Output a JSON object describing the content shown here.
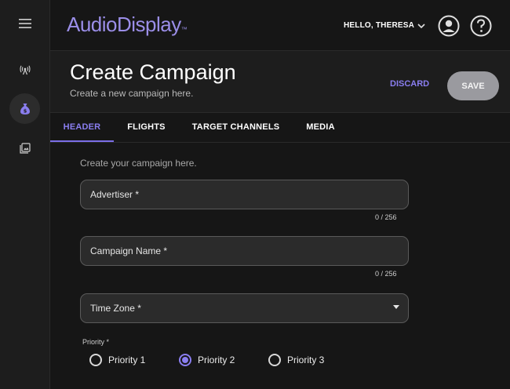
{
  "app": {
    "logo_text": "AudioDisplay",
    "logo_tm": "™"
  },
  "user": {
    "greeting": "HELLO, THERESA"
  },
  "header": {
    "title": "Create Campaign",
    "subtitle": "Create a new campaign here.",
    "discard_label": "DISCARD",
    "save_label": "SAVE"
  },
  "tabs": [
    {
      "label": "HEADER",
      "active": true
    },
    {
      "label": "FLIGHTS",
      "active": false
    },
    {
      "label": "TARGET CHANNELS",
      "active": false
    },
    {
      "label": "MEDIA",
      "active": false
    }
  ],
  "form": {
    "intro": "Create your campaign here.",
    "advertiser": {
      "label": "Advertiser *",
      "value": "",
      "counter": "0 / 256"
    },
    "campaign_name": {
      "label": "Campaign Name *",
      "value": "",
      "counter": "0 / 256"
    },
    "time_zone": {
      "label": "Time Zone *",
      "value": ""
    },
    "priority": {
      "label": "Priority *",
      "options": [
        "Priority 1",
        "Priority 2",
        "Priority 3"
      ],
      "selected": "Priority 2"
    }
  },
  "colors": {
    "accent": "#8a7ef0",
    "logo": "#9b8ee8",
    "background": "#161616",
    "panel": "#1d1d1d",
    "field": "#2b2b2b",
    "save_button": "#9a9a9f"
  },
  "icons": {
    "rail": [
      "menu-icon",
      "broadcast-icon",
      "money-bag-icon",
      "media-icon"
    ],
    "topbar": [
      "chevron-down-icon",
      "account-circle-icon",
      "help-circle-icon"
    ]
  }
}
